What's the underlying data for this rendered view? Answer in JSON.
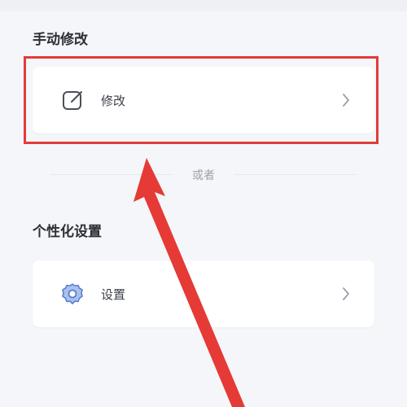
{
  "manual_section": {
    "title": "手动修改",
    "item_label": "修改",
    "item_icon": "edit-icon"
  },
  "separator": {
    "text": "或者"
  },
  "personal_section": {
    "title": "个性化设置",
    "item_label": "设置",
    "item_icon": "gear-icon"
  },
  "colors": {
    "highlight": "#e23b3b",
    "accent_icon": "#5b7fd0",
    "background": "#f4f6f9"
  }
}
